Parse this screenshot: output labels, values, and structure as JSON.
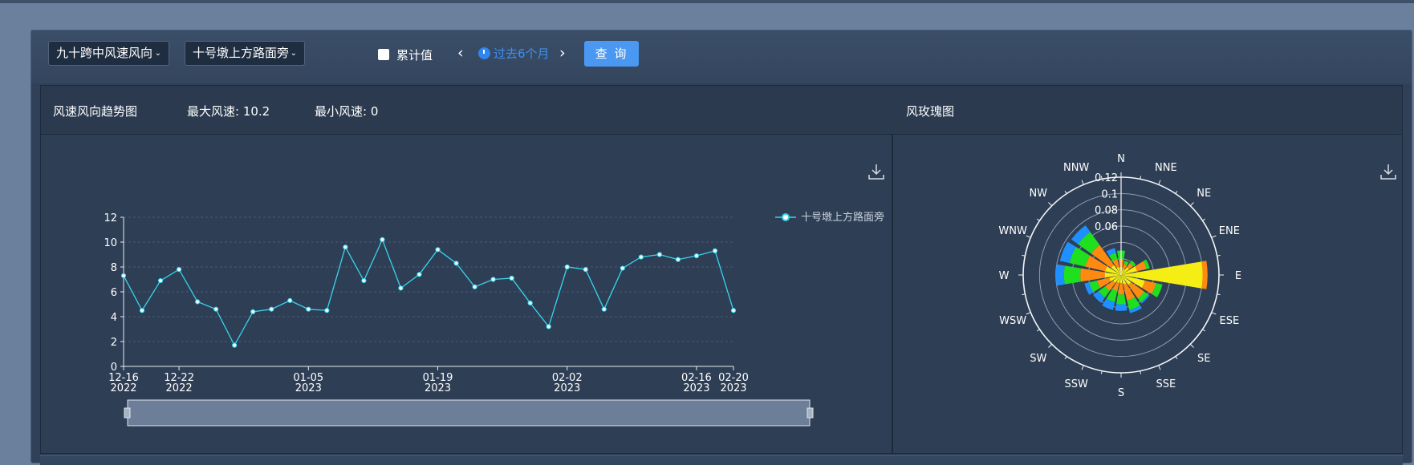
{
  "toolbar": {
    "metric_select": "九十跨中风速风向",
    "sensor_select": "十号墩上方路面旁",
    "cumulative_label": "累计值",
    "prev_arrow": "‹",
    "next_arrow": "›",
    "range_label": "过去6个月",
    "query_button": "查 询"
  },
  "header": {
    "trend_title": "风速风向趋势图",
    "max_speed": "最大风速: 10.2",
    "min_speed": "最小风速: 0",
    "rose_title": "风玫瑰图"
  },
  "colors": {
    "line": "#36d6ec",
    "legend": "#36d6ec",
    "rose_blue": "#1e90ff",
    "rose_green": "#1ee01e",
    "rose_orange": "#ff8a10",
    "rose_yellow": "#f5ee14",
    "accent": "#4a98f2"
  },
  "icons": [
    "download-icon",
    "clock-icon",
    "chevron-down-icon",
    "chevron-left-icon",
    "chevron-right-icon"
  ],
  "chart_data": [
    {
      "type": "line",
      "title": "风速风向趋势图",
      "legend": "十号墩上方路面旁",
      "x": [
        "2022-12-16",
        "2022-12-18",
        "2022-12-20",
        "2022-12-22",
        "2022-12-24",
        "2022-12-26",
        "2022-12-28",
        "2022-12-30",
        "2023-01-01",
        "2023-01-03",
        "2023-01-05",
        "2023-01-07",
        "2023-01-09",
        "2023-01-11",
        "2023-01-13",
        "2023-01-15",
        "2023-01-17",
        "2023-01-19",
        "2023-01-21",
        "2023-01-23",
        "2023-01-25",
        "2023-01-27",
        "2023-01-29",
        "2023-01-31",
        "2023-02-02",
        "2023-02-04",
        "2023-02-06",
        "2023-02-08",
        "2023-02-10",
        "2023-02-12",
        "2023-02-14",
        "2023-02-16",
        "2023-02-18",
        "2023-02-20"
      ],
      "series": [
        {
          "name": "十号墩上方路面旁",
          "values": [
            7.3,
            4.5,
            6.9,
            7.8,
            5.2,
            4.6,
            1.7,
            4.4,
            4.6,
            5.3,
            4.6,
            4.5,
            9.6,
            6.9,
            10.2,
            6.3,
            7.4,
            9.4,
            8.3,
            6.4,
            7.0,
            7.1,
            5.1,
            3.2,
            8.0,
            7.8,
            4.6,
            7.9,
            8.8,
            9.0,
            8.6,
            8.9,
            9.3,
            4.5
          ]
        }
      ],
      "x_tick_labels": [
        [
          "12-16",
          "2022"
        ],
        [
          "12-22",
          "2022"
        ],
        [
          "01-05",
          "2023"
        ],
        [
          "01-19",
          "2023"
        ],
        [
          "02-02",
          "2023"
        ],
        [
          "02-16",
          "2023"
        ],
        [
          "02-20",
          "2023"
        ]
      ],
      "y_ticks": [
        "0",
        "2",
        "4",
        "6",
        "8",
        "10",
        "12"
      ],
      "ylim": [
        0,
        12
      ],
      "grid": true,
      "legend_position": "top-right"
    },
    {
      "type": "polar-bar",
      "title": "风玫瑰图",
      "directions": [
        "N",
        "NNE",
        "NE",
        "ENE",
        "E",
        "ESE",
        "SE",
        "SSE",
        "S",
        "SSW",
        "SW",
        "WSW",
        "W",
        "WNW",
        "NW",
        "NNW"
      ],
      "r_ticks": [
        "0.12",
        "0.1",
        "0.08",
        "0.06"
      ],
      "rlim": [
        0,
        0.12
      ],
      "series": [
        {
          "color": "yellow",
          "values": [
            0.01,
            0.008,
            0.012,
            0.02,
            0.1,
            0.03,
            0.015,
            0.012,
            0.01,
            0.01,
            0.012,
            0.015,
            0.02,
            0.02,
            0.015,
            0.01
          ]
        },
        {
          "color": "orange",
          "values": [
            0.01,
            0.006,
            0.006,
            0.012,
            0.006,
            0.014,
            0.02,
            0.02,
            0.014,
            0.01,
            0.012,
            0.015,
            0.03,
            0.025,
            0.03,
            0.01
          ]
        },
        {
          "color": "green",
          "values": [
            0.01,
            0.004,
            0.004,
            0.004,
            0.0,
            0.008,
            0.006,
            0.012,
            0.012,
            0.014,
            0.01,
            0.01,
            0.02,
            0.02,
            0.02,
            0.008
          ]
        },
        {
          "color": "blue",
          "values": [
            0.0,
            0.0,
            0.0,
            0.0,
            0.0,
            0.0,
            0.002,
            0.004,
            0.008,
            0.01,
            0.008,
            0.006,
            0.01,
            0.012,
            0.01,
            0.006
          ]
        }
      ]
    }
  ]
}
